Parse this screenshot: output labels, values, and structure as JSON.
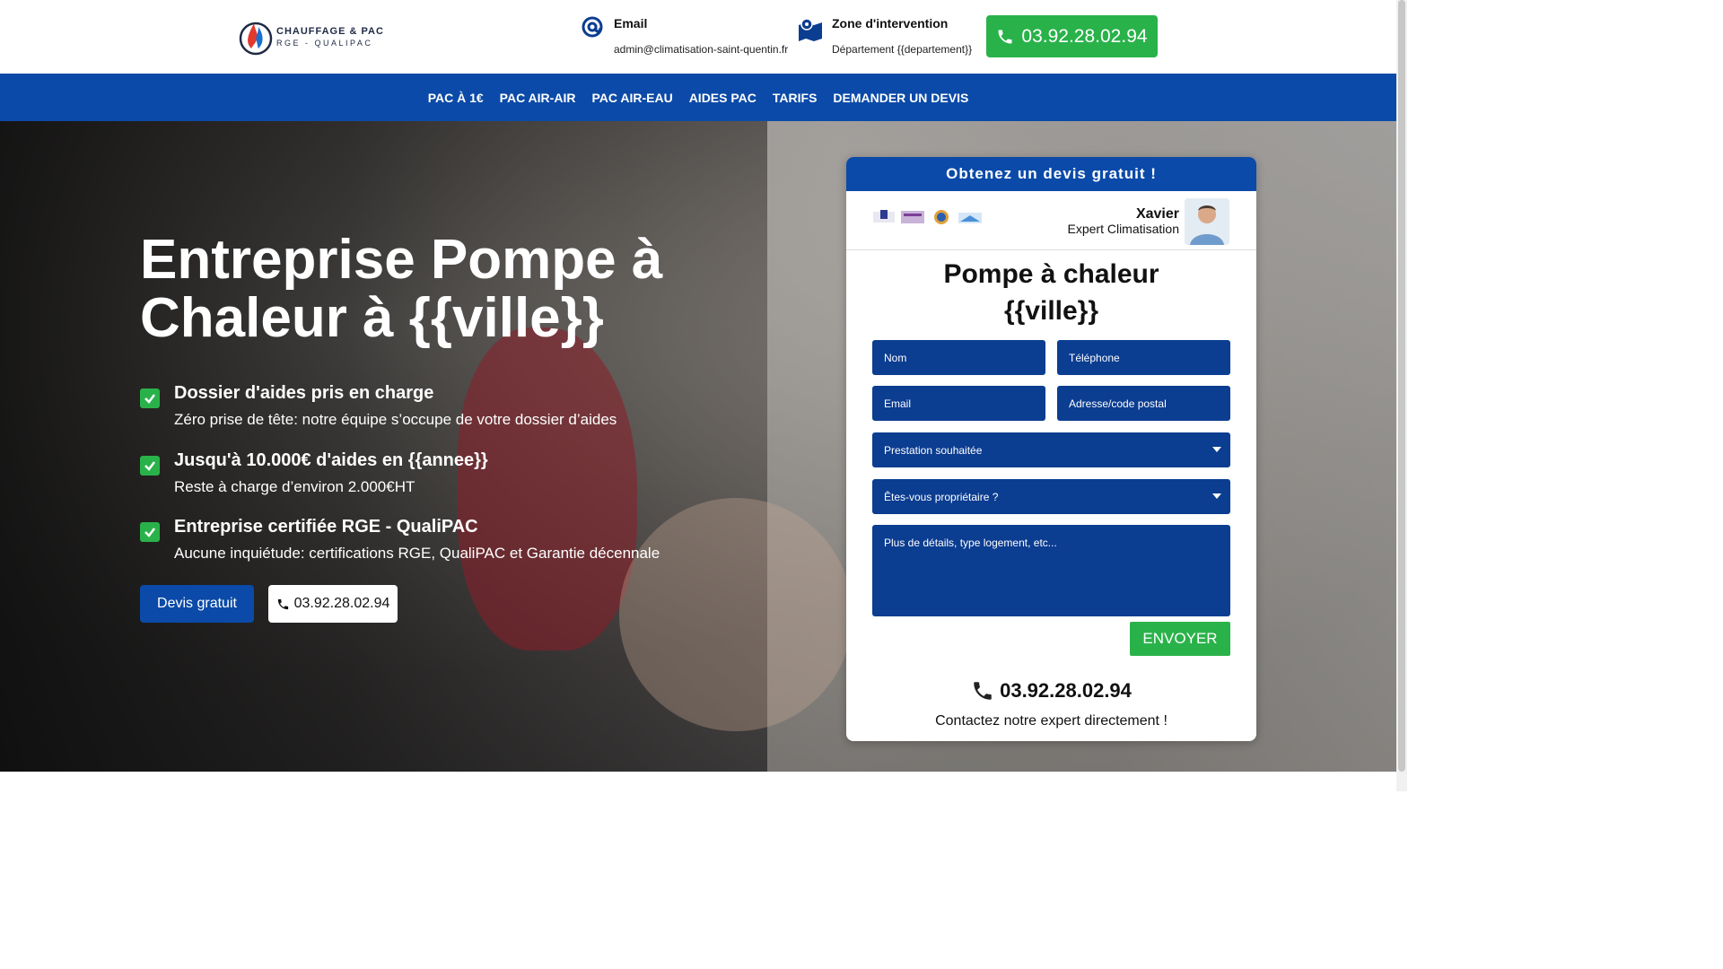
{
  "header": {
    "logo_line1": "CHAUFFAGE & PAC",
    "logo_line2": "RGE - QUALIPAC",
    "email_title": "Email",
    "email_value": "admin@climatisation-saint-quentin.fr",
    "zone_title": "Zone d'intervention",
    "zone_value": "Département {{departement}}",
    "phone": "03.92.28.02.94"
  },
  "nav": {
    "items": [
      "PAC À 1€",
      "PAC AIR-AIR",
      "PAC AIR-EAU",
      "AIDES PAC",
      "TARIFS",
      "DEMANDER UN DEVIS"
    ]
  },
  "hero": {
    "title": "Entreprise Pompe à Chaleur à {{ville}}",
    "features": [
      {
        "title": "Dossier d'aides pris en charge",
        "sub": "Zéro prise de tête: notre équipe s’occupe de votre dossier d’aides"
      },
      {
        "title": "Jusqu'à 10.000€ d'aides en {{annee}}",
        "sub": "Reste à charge d’environ 2.000€HT"
      },
      {
        "title": "Entreprise certifiée RGE - QualiPAC",
        "sub": "Aucune inquiétude: certifications RGE, QualiPAC et Garantie décennale"
      }
    ],
    "btn_devis": "Devis gratuit",
    "btn_phone": "03.92.28.02.94"
  },
  "form": {
    "header": "Obtenez un devis gratuit !",
    "expert_name": "Xavier",
    "expert_role": "Expert Climatisation",
    "title_line1": "Pompe à chaleur",
    "title_line2": "{{ville}}",
    "placeholders": {
      "nom": "Nom",
      "telephone": "Téléphone",
      "email": "Email",
      "adresse": "Adresse/code postal",
      "prestation": "Prestation souhaitée",
      "proprietaire": "Êtes-vous propriétaire ?",
      "details": "Plus de détails, type logement, etc..."
    },
    "submit": "ENVOYER",
    "phone": "03.92.28.02.94",
    "contact": "Contactez notre expert directement !"
  },
  "colors": {
    "primary_blue": "#0b4aa8",
    "field_blue": "#0b3d91",
    "green": "#2ab24a"
  }
}
